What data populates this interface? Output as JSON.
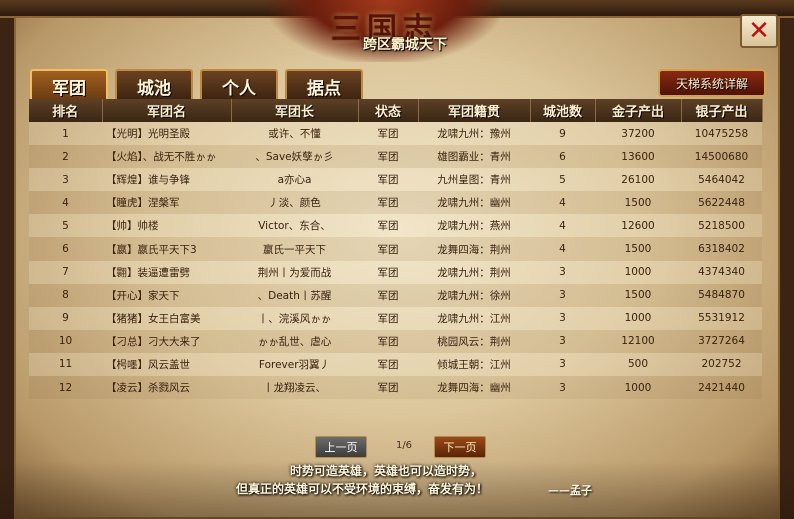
{
  "banner": {
    "title": "三国志",
    "subtitle": "跨区霸城天下"
  },
  "close_label": "✕",
  "tabs": [
    {
      "label": "军团"
    },
    {
      "label": "城池"
    },
    {
      "label": "个人"
    },
    {
      "label": "据点"
    }
  ],
  "ladder_button": "天梯系统详解",
  "table": {
    "headers": [
      "排名",
      "军团名",
      "军团长",
      "状态",
      "军团籍贯",
      "城池数",
      "金子产出",
      "银子产出"
    ],
    "rows": [
      [
        "1",
        "【光明】光明圣殿",
        "或许、不懂",
        "军团",
        "龙啸九州：豫州",
        "9",
        "37200",
        "10475258"
      ],
      [
        "2",
        "【火焰】、战无不胜ゕゕ",
        "、Save妖孽ゕ彡",
        "军团",
        "雄图霸业：青州",
        "6",
        "13600",
        "14500680"
      ],
      [
        "3",
        "【辉煌】谁与争锋",
        "a亦心a",
        "军团",
        "九州皇图：青州",
        "5",
        "26100",
        "5464042"
      ],
      [
        "4",
        "【瞳虎】涅槃军",
        "丿淡、颜色",
        "军团",
        "龙啸九州：幽州",
        "4",
        "1500",
        "5622448"
      ],
      [
        "5",
        "【帅】帅楼",
        "Victor、东合、",
        "军团",
        "龙啸九州：燕州",
        "4",
        "12600",
        "5218500"
      ],
      [
        "6",
        "【嬴】嬴氏平天下3",
        "嬴氏一平天下",
        "军团",
        "龙舞四海：荆州",
        "4",
        "1500",
        "6318402"
      ],
      [
        "7",
        "【翾】装逼遭雷劈",
        "荆州丨为爱而战",
        "军团",
        "龙啸九州：荆州",
        "3",
        "1000",
        "4374340"
      ],
      [
        "8",
        "【开心】家天下",
        "、Death丨苏醒",
        "军团",
        "龙啸九州：徐州",
        "3",
        "1500",
        "5484870"
      ],
      [
        "9",
        "【猪猪】女王白富美",
        "丨、浣溪风ゕゕ",
        "军团",
        "龙啸九州：江州",
        "3",
        "1000",
        "5531912"
      ],
      [
        "10",
        "【刁总】刁大大来了",
        "ゕゕ乱世、虐心",
        "军团",
        "桃园风云：荆州",
        "3",
        "12100",
        "3727264"
      ],
      [
        "11",
        "【枵嚜】风云盖世",
        "Forever羽翼丿",
        "军团",
        "倾城王朝：江州",
        "3",
        "500",
        "202752"
      ],
      [
        "12",
        "【凌云】杀戮风云",
        "丨龙翔凌云、",
        "军团",
        "龙舞四海：幽州",
        "3",
        "1000",
        "2421440"
      ]
    ]
  },
  "pager": {
    "prev": "上一页",
    "info": "1/6",
    "next": "下一页"
  },
  "quote": {
    "line1": "时势可造英雄，英雄也可以造时势，",
    "line2": "但真正的英雄可以不受环境的束缚，奋发有为！",
    "signature": "——孟子"
  }
}
